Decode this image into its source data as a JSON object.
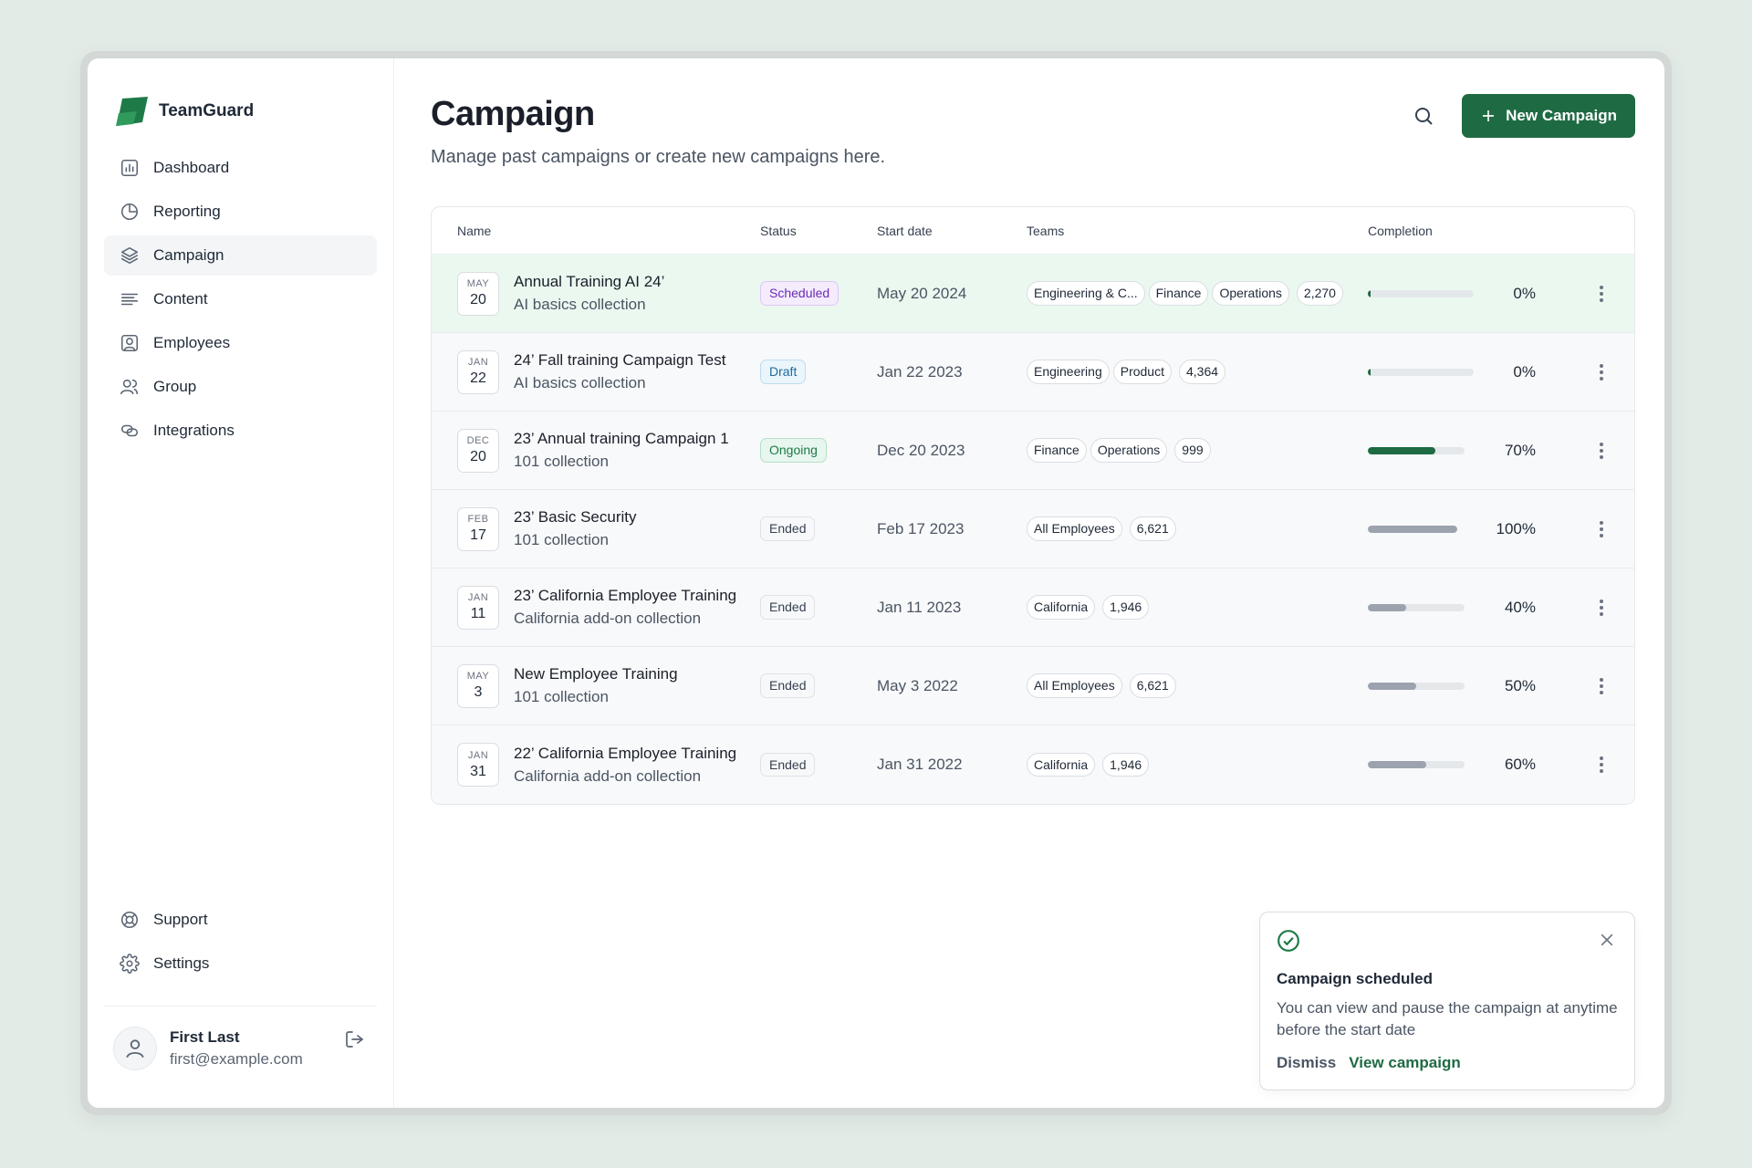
{
  "brand": {
    "name": "TeamGuard",
    "logo_color": "#1e7a47"
  },
  "sidebar": {
    "items": [
      {
        "label": "Dashboard",
        "icon": "chart-bar-icon",
        "active": false
      },
      {
        "label": "Reporting",
        "icon": "pie-chart-icon",
        "active": false
      },
      {
        "label": "Campaign",
        "icon": "layers-icon",
        "active": true
      },
      {
        "label": "Content",
        "icon": "lines-icon",
        "active": false
      },
      {
        "label": "Employees",
        "icon": "user-square-icon",
        "active": false
      },
      {
        "label": "Group",
        "icon": "users-icon",
        "active": false
      },
      {
        "label": "Integrations",
        "icon": "link-icon",
        "active": false
      }
    ],
    "bottom_items": [
      {
        "label": "Support",
        "icon": "life-buoy-icon"
      },
      {
        "label": "Settings",
        "icon": "gear-icon"
      }
    ],
    "user": {
      "name": "First Last",
      "email": "first@example.com"
    }
  },
  "header": {
    "title": "Campaign",
    "subtitle": "Manage past campaigns or create new campaigns here.",
    "new_button": "New Campaign"
  },
  "table": {
    "columns": {
      "name": "Name",
      "status": "Status",
      "start": "Start date",
      "teams": "Teams",
      "completion": "Completion"
    },
    "rows": [
      {
        "mon": "MAY",
        "day": "20",
        "title": "Annual Training AI 24’",
        "sub": "AI basics collection",
        "status": "Scheduled",
        "status_kind": "scheduled",
        "start": "May 20 2024",
        "teams": [
          "Engineering & C...",
          "Finance",
          "Operations"
        ],
        "count": "2,270",
        "completion": 0,
        "pct": "0%",
        "highlight": true
      },
      {
        "mon": "JAN",
        "day": "22",
        "title": "24’ Fall training Campaign Test",
        "sub": "AI basics collection",
        "status": "Draft",
        "status_kind": "draft",
        "start": "Jan 22 2023",
        "teams": [
          "Engineering",
          "Product"
        ],
        "count": "4,364",
        "completion": 0,
        "pct": "0%",
        "highlight": false
      },
      {
        "mon": "DEC",
        "day": "20",
        "title": "23’ Annual training Campaign 1",
        "sub": "101 collection",
        "status": "Ongoing",
        "status_kind": "ongoing",
        "start": "Dec 20 2023",
        "teams": [
          "Finance",
          "Operations"
        ],
        "count": "999",
        "completion": 70,
        "pct": "70%",
        "highlight": false
      },
      {
        "mon": "FEB",
        "day": "17",
        "title": "23’ Basic Security",
        "sub": "101 collection",
        "status": "Ended",
        "status_kind": "ended",
        "start": "Feb 17 2023",
        "teams": [
          "All Employees"
        ],
        "count": "6,621",
        "completion": 100,
        "pct": "100%",
        "highlight": false
      },
      {
        "mon": "JAN",
        "day": "11",
        "title": "23’ California Employee Training",
        "sub": "California add-on collection",
        "status": "Ended",
        "status_kind": "ended",
        "start": "Jan 11 2023",
        "teams": [
          "California"
        ],
        "count": "1,946",
        "completion": 40,
        "pct": "40%",
        "highlight": false
      },
      {
        "mon": "MAY",
        "day": "3",
        "title": "New Employee Training",
        "sub": "101 collection",
        "status": "Ended",
        "status_kind": "ended",
        "start": "May 3 2022",
        "teams": [
          "All Employees"
        ],
        "count": "6,621",
        "completion": 50,
        "pct": "50%",
        "highlight": false
      },
      {
        "mon": "JAN",
        "day": "31",
        "title": "22’ California Employee Training",
        "sub": "California add-on collection",
        "status": "Ended",
        "status_kind": "ended",
        "start": "Jan 31 2022",
        "teams": [
          "California"
        ],
        "count": "1,946",
        "completion": 60,
        "pct": "60%",
        "highlight": false
      }
    ]
  },
  "toast": {
    "title": "Campaign scheduled",
    "message": "You can view and pause the campaign at anytime before the start date",
    "dismiss": "Dismiss",
    "view": "View campaign"
  },
  "colors": {
    "primary": "#1e6b43",
    "bar_active": "#1e6b43",
    "bar_ended": "#9ca3af",
    "row_highlight": "#ebf8f0"
  }
}
